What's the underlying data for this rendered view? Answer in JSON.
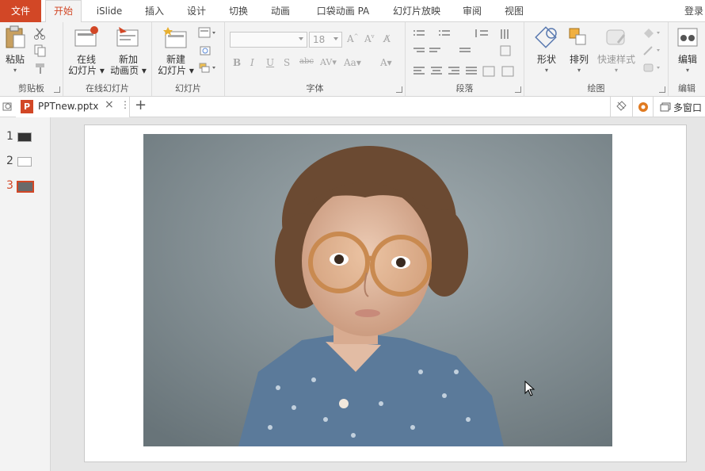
{
  "tabs": {
    "file": "文件",
    "home": "开始",
    "islide": "iSlide",
    "insert": "插入",
    "design": "设计",
    "transitions": "切换",
    "animations": "动画",
    "pocket_animation": "口袋动画 PA",
    "slideshow": "幻灯片放映",
    "review": "审阅",
    "view": "视图",
    "login": "登录"
  },
  "ribbon": {
    "clipboard": {
      "label": "剪贴板",
      "paste": "粘贴"
    },
    "online": {
      "label": "在线幻灯片",
      "online_slides_1": "在线",
      "online_slides_2": "幻灯片",
      "new_anim_1": "新加",
      "new_anim_2": "动画页"
    },
    "slides": {
      "label": "幻灯片",
      "new_slide_1": "新建",
      "new_slide_2": "幻灯片"
    },
    "font": {
      "label": "字体",
      "font_name": "",
      "font_size": "18"
    },
    "paragraph": {
      "label": "段落"
    },
    "drawing": {
      "label": "绘图",
      "shapes": "形状",
      "arrange": "排列",
      "quick_styles": "快速样式"
    },
    "editing": {
      "label": "编辑",
      "edit": "编辑"
    }
  },
  "document": {
    "file_name": "PPTnew.pptx",
    "multi_window": "多窗口"
  },
  "slides": {
    "items": [
      {
        "number": "1",
        "selected": false
      },
      {
        "number": "2",
        "selected": false
      },
      {
        "number": "3",
        "selected": true
      }
    ]
  },
  "colors": {
    "accent": "#d24726",
    "ribbon_bg": "#f3f3f3",
    "workspace_bg": "#e6e6e6"
  }
}
